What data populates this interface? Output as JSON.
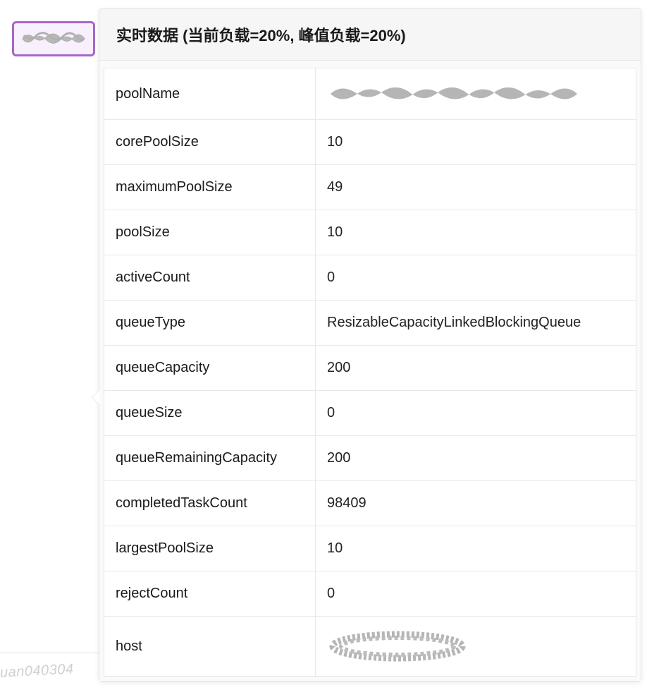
{
  "header": {
    "title": "实时数据 (当前负载=20%, 峰值负载=20%)"
  },
  "table": {
    "rows": [
      {
        "key": "poolName",
        "value": "",
        "redacted": "wide"
      },
      {
        "key": "corePoolSize",
        "value": "10"
      },
      {
        "key": "maximumPoolSize",
        "value": "49"
      },
      {
        "key": "poolSize",
        "value": "10"
      },
      {
        "key": "activeCount",
        "value": "0"
      },
      {
        "key": "queueType",
        "value": "ResizableCapacityLinkedBlockingQueue"
      },
      {
        "key": "queueCapacity",
        "value": "200"
      },
      {
        "key": "queueSize",
        "value": "0"
      },
      {
        "key": "queueRemainingCapacity",
        "value": "200"
      },
      {
        "key": "completedTaskCount",
        "value": "98409"
      },
      {
        "key": "largestPoolSize",
        "value": "10"
      },
      {
        "key": "rejectCount",
        "value": "0"
      },
      {
        "key": "host",
        "value": "",
        "redacted": "oval"
      }
    ]
  },
  "watermark": "uan040304"
}
